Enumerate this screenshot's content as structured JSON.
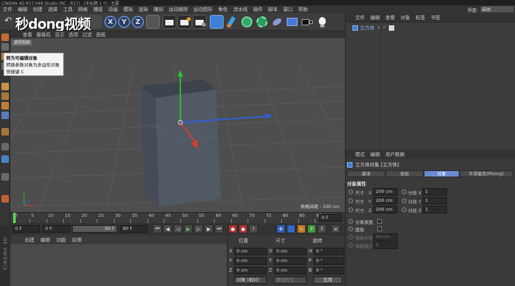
{
  "window": {
    "title": "CINEMA 4D R17.048 Studio (RC - R17) - [未标题 1 *] - 主要"
  },
  "menubar": {
    "items": [
      "文件",
      "编辑",
      "创建",
      "选择",
      "工具",
      "网格",
      "捕捉",
      "动画",
      "模拟",
      "渲染",
      "雕刻",
      "运动跟踪",
      "运动图形",
      "角色",
      "流水线",
      "插件",
      "脚本",
      "窗口",
      "帮助"
    ]
  },
  "interface": {
    "label": "界面:",
    "value": "启动"
  },
  "watermark": "秒dong视频",
  "toolbar": {
    "axis_x": "X",
    "axis_y": "Y",
    "axis_z": "Z"
  },
  "viewport": {
    "menu": [
      "查看",
      "摄像机",
      "显示",
      "选项",
      "过滤",
      "面板"
    ],
    "label": "透视视图",
    "grid_label": "网格间距 : 100 cm"
  },
  "tooltip": {
    "title": "转为可编辑对象",
    "line1": "转换参数对象为多边形对象",
    "line2": "快捷键 C"
  },
  "timeline": {
    "ticks": [
      "0",
      "5",
      "10",
      "15",
      "20",
      "25",
      "30",
      "35",
      "40",
      "45",
      "50",
      "55",
      "60",
      "65",
      "70",
      "75",
      "80",
      "85",
      "90"
    ],
    "frame_end": "0 F"
  },
  "playback": {
    "start": "0 F",
    "current": "0 F",
    "range_end": "90 F",
    "end": "90 F"
  },
  "materials": {
    "menu": [
      "创建",
      "编辑",
      "功能",
      "纹理"
    ],
    "side_label": "CINEMA 4D"
  },
  "coordinates": {
    "headers": {
      "position": "位置",
      "size": "尺寸",
      "rotation": "旋转"
    },
    "rows": [
      {
        "axis": "X",
        "pos": "0 cm",
        "size_axis": "X",
        "size": "0 cm",
        "rot_axis": "H",
        "rot": "0 °"
      },
      {
        "axis": "Y",
        "pos": "0 cm",
        "size_axis": "Y",
        "size": "0 cm",
        "rot_axis": "P",
        "rot": "0 °"
      },
      {
        "axis": "Z",
        "pos": "0 cm",
        "size_axis": "Z",
        "size": "0 cm",
        "rot_axis": "B",
        "rot": "0 °"
      }
    ],
    "mode_select": "对象 (相对)",
    "size_select": "绝对尺寸",
    "apply": "应用"
  },
  "object_manager": {
    "menu": [
      "文件",
      "编辑",
      "查看",
      "对象",
      "标签",
      "书签"
    ],
    "objects": [
      {
        "name": "立方体"
      }
    ]
  },
  "attribute_manager": {
    "menu": [
      "模式",
      "编辑",
      "用户数据"
    ],
    "title": "立方体对象 [立方体]",
    "tabs": [
      "基本",
      "坐标",
      "对象",
      "平滑着色(Phong)"
    ],
    "active_tab": "对象",
    "section": "对象属性",
    "size": [
      {
        "label": "尺寸 . X",
        "value": "200 cm",
        "seg_label": "分段 X",
        "seg": "1"
      },
      {
        "label": "尺寸 . Y",
        "value": "200 cm",
        "seg_label": "分段 Y",
        "seg": "1"
      },
      {
        "label": "尺寸 . Z",
        "value": "200 cm",
        "seg_label": "分段 Z",
        "seg": "1"
      }
    ],
    "separate_surfaces": "分离表面",
    "fillet": "圆角",
    "fillet_radius_label": "圆角半径",
    "fillet_radius": "40 cm",
    "fillet_subdiv_label": "圆角细分",
    "fillet_subdiv": "5"
  },
  "colors": {
    "accent": "#6a8bd4",
    "axis_x": "#e03a2a",
    "axis_y": "#2cc02c",
    "axis_z": "#2f5fe0",
    "cube": "#4b5360"
  }
}
